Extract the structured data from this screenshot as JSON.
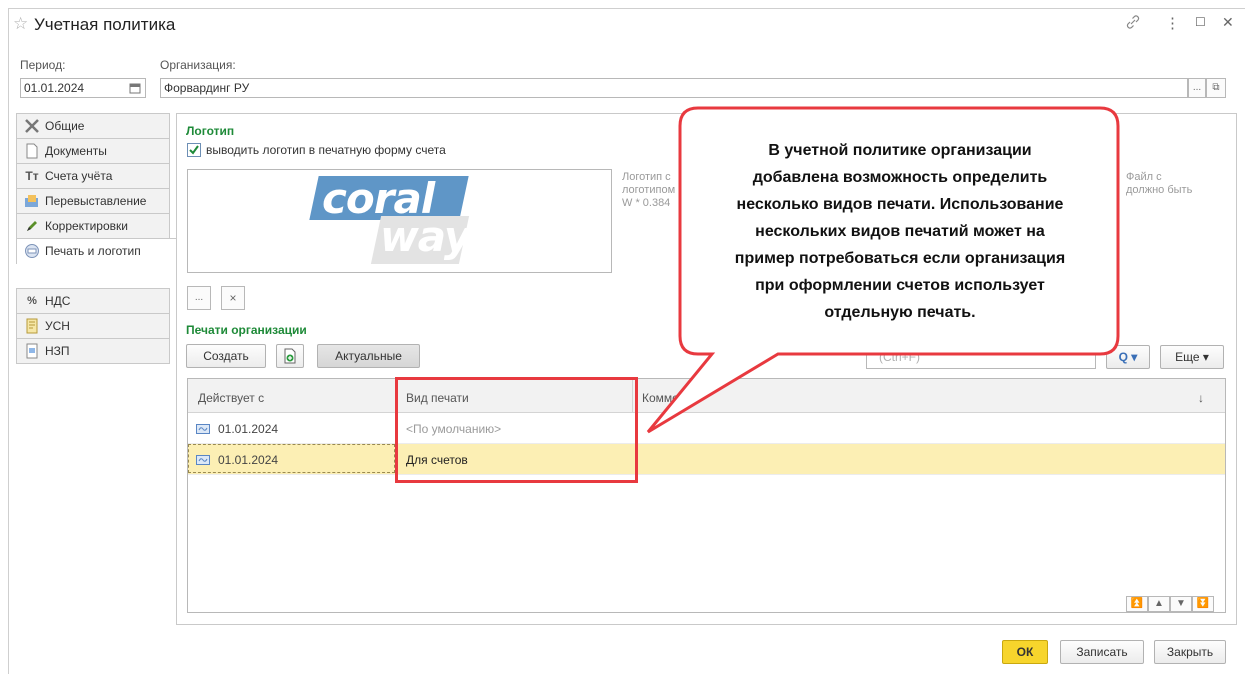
{
  "window": {
    "title": "Учетная политика",
    "controls": [
      "⋮",
      "☐",
      "✕"
    ]
  },
  "period": {
    "label": "Период:",
    "value": "01.01.2024"
  },
  "organization": {
    "label": "Организация:",
    "value": "Форвардинг РУ",
    "more_button": "...",
    "open_button": "⧉"
  },
  "tabs": [
    {
      "label": "Общие",
      "icon": "tools-icon"
    },
    {
      "label": "Документы",
      "icon": "document-icon"
    },
    {
      "label": "Счета учёта",
      "icon": "accounts-icon"
    },
    {
      "label": "Перевыставление",
      "icon": "reissue-icon"
    },
    {
      "label": "Корректировки",
      "icon": "pencil-icon"
    },
    {
      "label": "Печать и логотип",
      "icon": "stamp-icon",
      "active": true
    },
    {
      "label": "НДС",
      "icon": "percent-icon"
    },
    {
      "label": "УСН",
      "icon": "book-icon"
    },
    {
      "label": "НЗП",
      "icon": "page-icon"
    }
  ],
  "logo_section": {
    "title": "Логотип",
    "checkbox_label": "выводить логотип в печатную форму счета",
    "checkbox_checked": true,
    "logo_words": [
      "coral",
      "way"
    ],
    "hint_left": [
      "Логотип с",
      "логотипом",
      "W * 0.384"
    ],
    "hint_right": [
      "Файл с",
      "должно быть"
    ],
    "select_button": "...",
    "clear_button": "×"
  },
  "stamps_section": {
    "title": "Печати организации",
    "create_button": "Создать",
    "current_button": "Актуальные",
    "search_placeholder": "(Ctrl+F)",
    "search_icon": "Q ▾",
    "more_button": "Еще ▾",
    "columns": [
      "Действует с",
      "Вид печати",
      "Комме",
      "↓"
    ],
    "rows": [
      {
        "date": "01.01.2024",
        "kind": "<По умолчанию>",
        "selected": false
      },
      {
        "date": "01.01.2024",
        "kind": "Для счетов",
        "selected": true
      }
    ],
    "nav_buttons": [
      "⏫",
      "▲",
      "▼",
      "⏬"
    ]
  },
  "callout": {
    "lines": [
      "В учетной политике организации",
      "добавлена возможность определить",
      "несколько видов печати. Использование",
      "нескольких видов печатий может  на",
      "пример потребоваться если организация",
      "при оформлении счетов использует",
      "отдельную печать."
    ]
  },
  "footer": {
    "ok": "ОК",
    "save": "Записать",
    "close": "Закрыть"
  },
  "colors": {
    "accent_green": "#1e8a38",
    "ok_yellow": "#f7d52c",
    "selected_row": "#fcefb4",
    "callout_red": "#e8393f"
  }
}
